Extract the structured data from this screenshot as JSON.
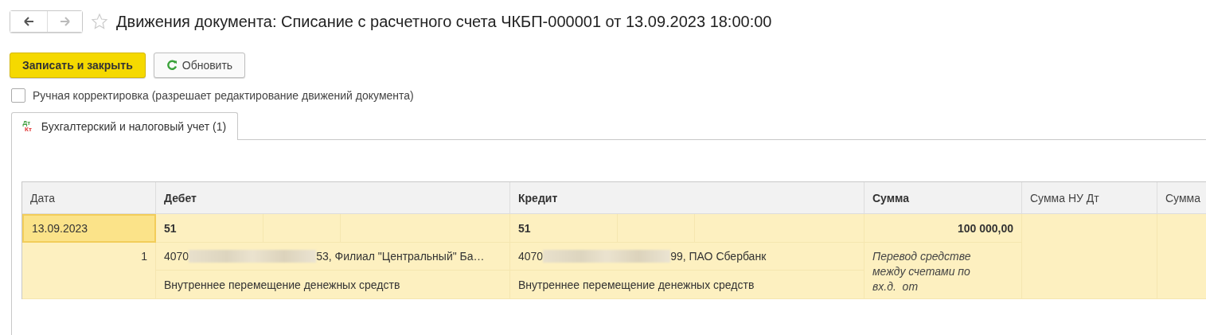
{
  "window": {
    "title": "Движения документа: Списание с расчетного счета ЧКБП-000001 от 13.09.2023 18:00:00",
    "favorite": false
  },
  "toolbar": {
    "buttons": [
      {
        "label": "Записать и закрыть",
        "kind": "primary"
      },
      {
        "label": "Обновить",
        "kind": "refresh"
      }
    ]
  },
  "manual_edit": {
    "label": "Ручная корректировка (разрешает редактирование движений документа)",
    "checked": false
  },
  "tabs": [
    {
      "label": "Бухгалтерский и налоговый учет (1)",
      "icon_top": "Дт",
      "icon_bottom": "Кт",
      "selected": true
    }
  ],
  "table": {
    "columns": [
      {
        "label": "Дата",
        "bold": false
      },
      {
        "label": "Дебет",
        "bold": true
      },
      {
        "label": "Кредит",
        "bold": true
      },
      {
        "label": "Сумма",
        "bold": true
      },
      {
        "label": "Сумма НУ Дт",
        "bold": false
      },
      {
        "label": "Сумма",
        "bold": false
      }
    ],
    "rows": [
      {
        "date": "13.09.2023",
        "selected": true,
        "number": "1",
        "debit": {
          "account": "51",
          "subconto_start": "4070",
          "subconto_end": "53, Филиал \"Центральный\" Ба…",
          "redacted": true,
          "content": "Внутреннее перемещение денежных средств"
        },
        "credit": {
          "account": "51",
          "subconto_start": "4070",
          "subconto_end": "99, ПАО Сбербанк",
          "redacted": true,
          "content": "Внутреннее перемещение денежных средств"
        },
        "amount": "100 000,00",
        "comment": "Перевод средстве\nмежду счетами по\nвх.д.  от"
      }
    ]
  }
}
